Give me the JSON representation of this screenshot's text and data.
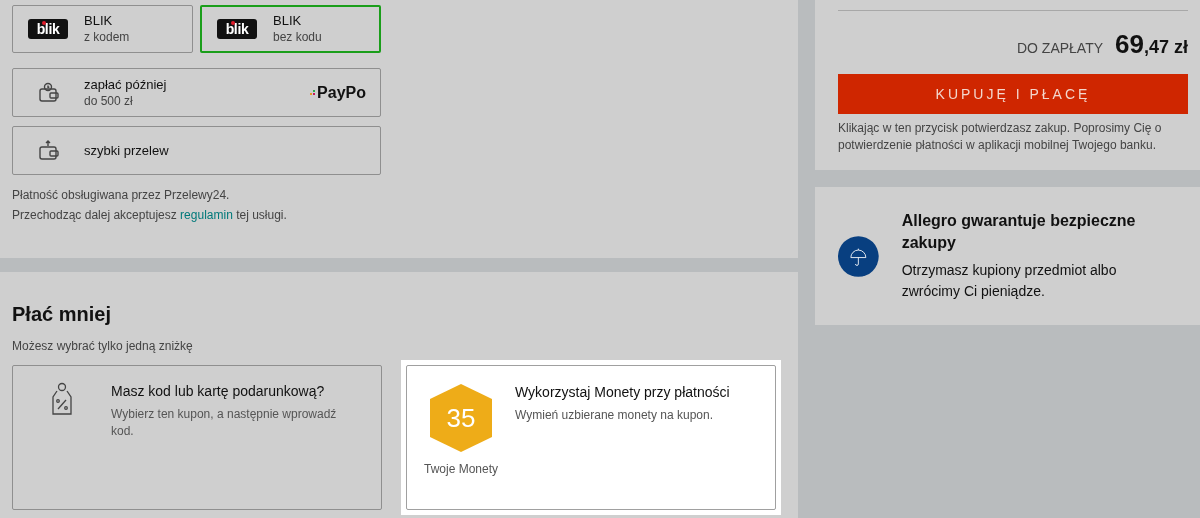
{
  "payment_methods": [
    {
      "kind": "blik",
      "logo": "blik",
      "title": "BLIK",
      "subtitle": "z kodem",
      "selected": false
    },
    {
      "kind": "blik",
      "logo": "blik",
      "title": "BLIK",
      "subtitle": "bez kodu",
      "selected": true
    },
    {
      "kind": "paylater",
      "title": "zapłać później",
      "subtitle": "do 500 zł",
      "brand": "PayPo",
      "selected": false
    },
    {
      "kind": "transfer",
      "title": "szybki przelew",
      "selected": false
    }
  ],
  "payment_note": "Płatność obsługiwana przez Przelewy24.",
  "terms_note": {
    "before": "Przechodząc dalej akceptujesz",
    "link": "regulamin",
    "after": "tej usługi."
  },
  "discounts": {
    "title": "Płać mniej",
    "subtitle": "Możesz wybrać tylko jedną zniżkę",
    "cards": [
      {
        "kind": "code",
        "title": "Masz kod lub kartę podarunkową?",
        "description": "Wybierz ten kupon, a następnie wprowadź kod.",
        "highlighted": false
      },
      {
        "kind": "coins",
        "count": "35",
        "caption": "Twoje Monety",
        "title": "Wykorzystaj Monety przy płatności",
        "description": "Wymień uzbierane monety na kupon.",
        "highlighted": true
      }
    ]
  },
  "summary": {
    "total_label": "DO ZAPŁATY",
    "total_whole": "69",
    "total_fraction": ",47 zł",
    "button": "KUPUJĘ I PŁACĘ",
    "note": "Klikając w ten przycisk potwierdzasz zakup. Poprosimy Cię o potwierdzenie płatności w aplikacji mobilnej Twojego banku."
  },
  "guarantee": {
    "title": "Allegro gwarantuje bezpieczne zakupy",
    "text": "Otrzymasz kupiony przedmiot albo zwrócimy Ci pieniądze."
  }
}
